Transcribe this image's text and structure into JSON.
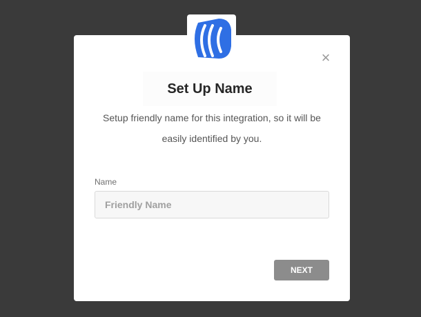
{
  "logo": {
    "icon": "brand-wave-icon",
    "color": "#2f6fe4"
  },
  "dialog": {
    "close_label": "×",
    "title": "Set Up Name",
    "description": "Setup friendly name for this integration, so it will be easily identified by you.",
    "name_field": {
      "label": "Name",
      "value": "",
      "placeholder": "Friendly Name"
    },
    "next_label": "NEXT"
  },
  "colors": {
    "backdrop": "#3a3a3a",
    "button_disabled": "#8c8c8c",
    "brand": "#2f6fe4"
  }
}
